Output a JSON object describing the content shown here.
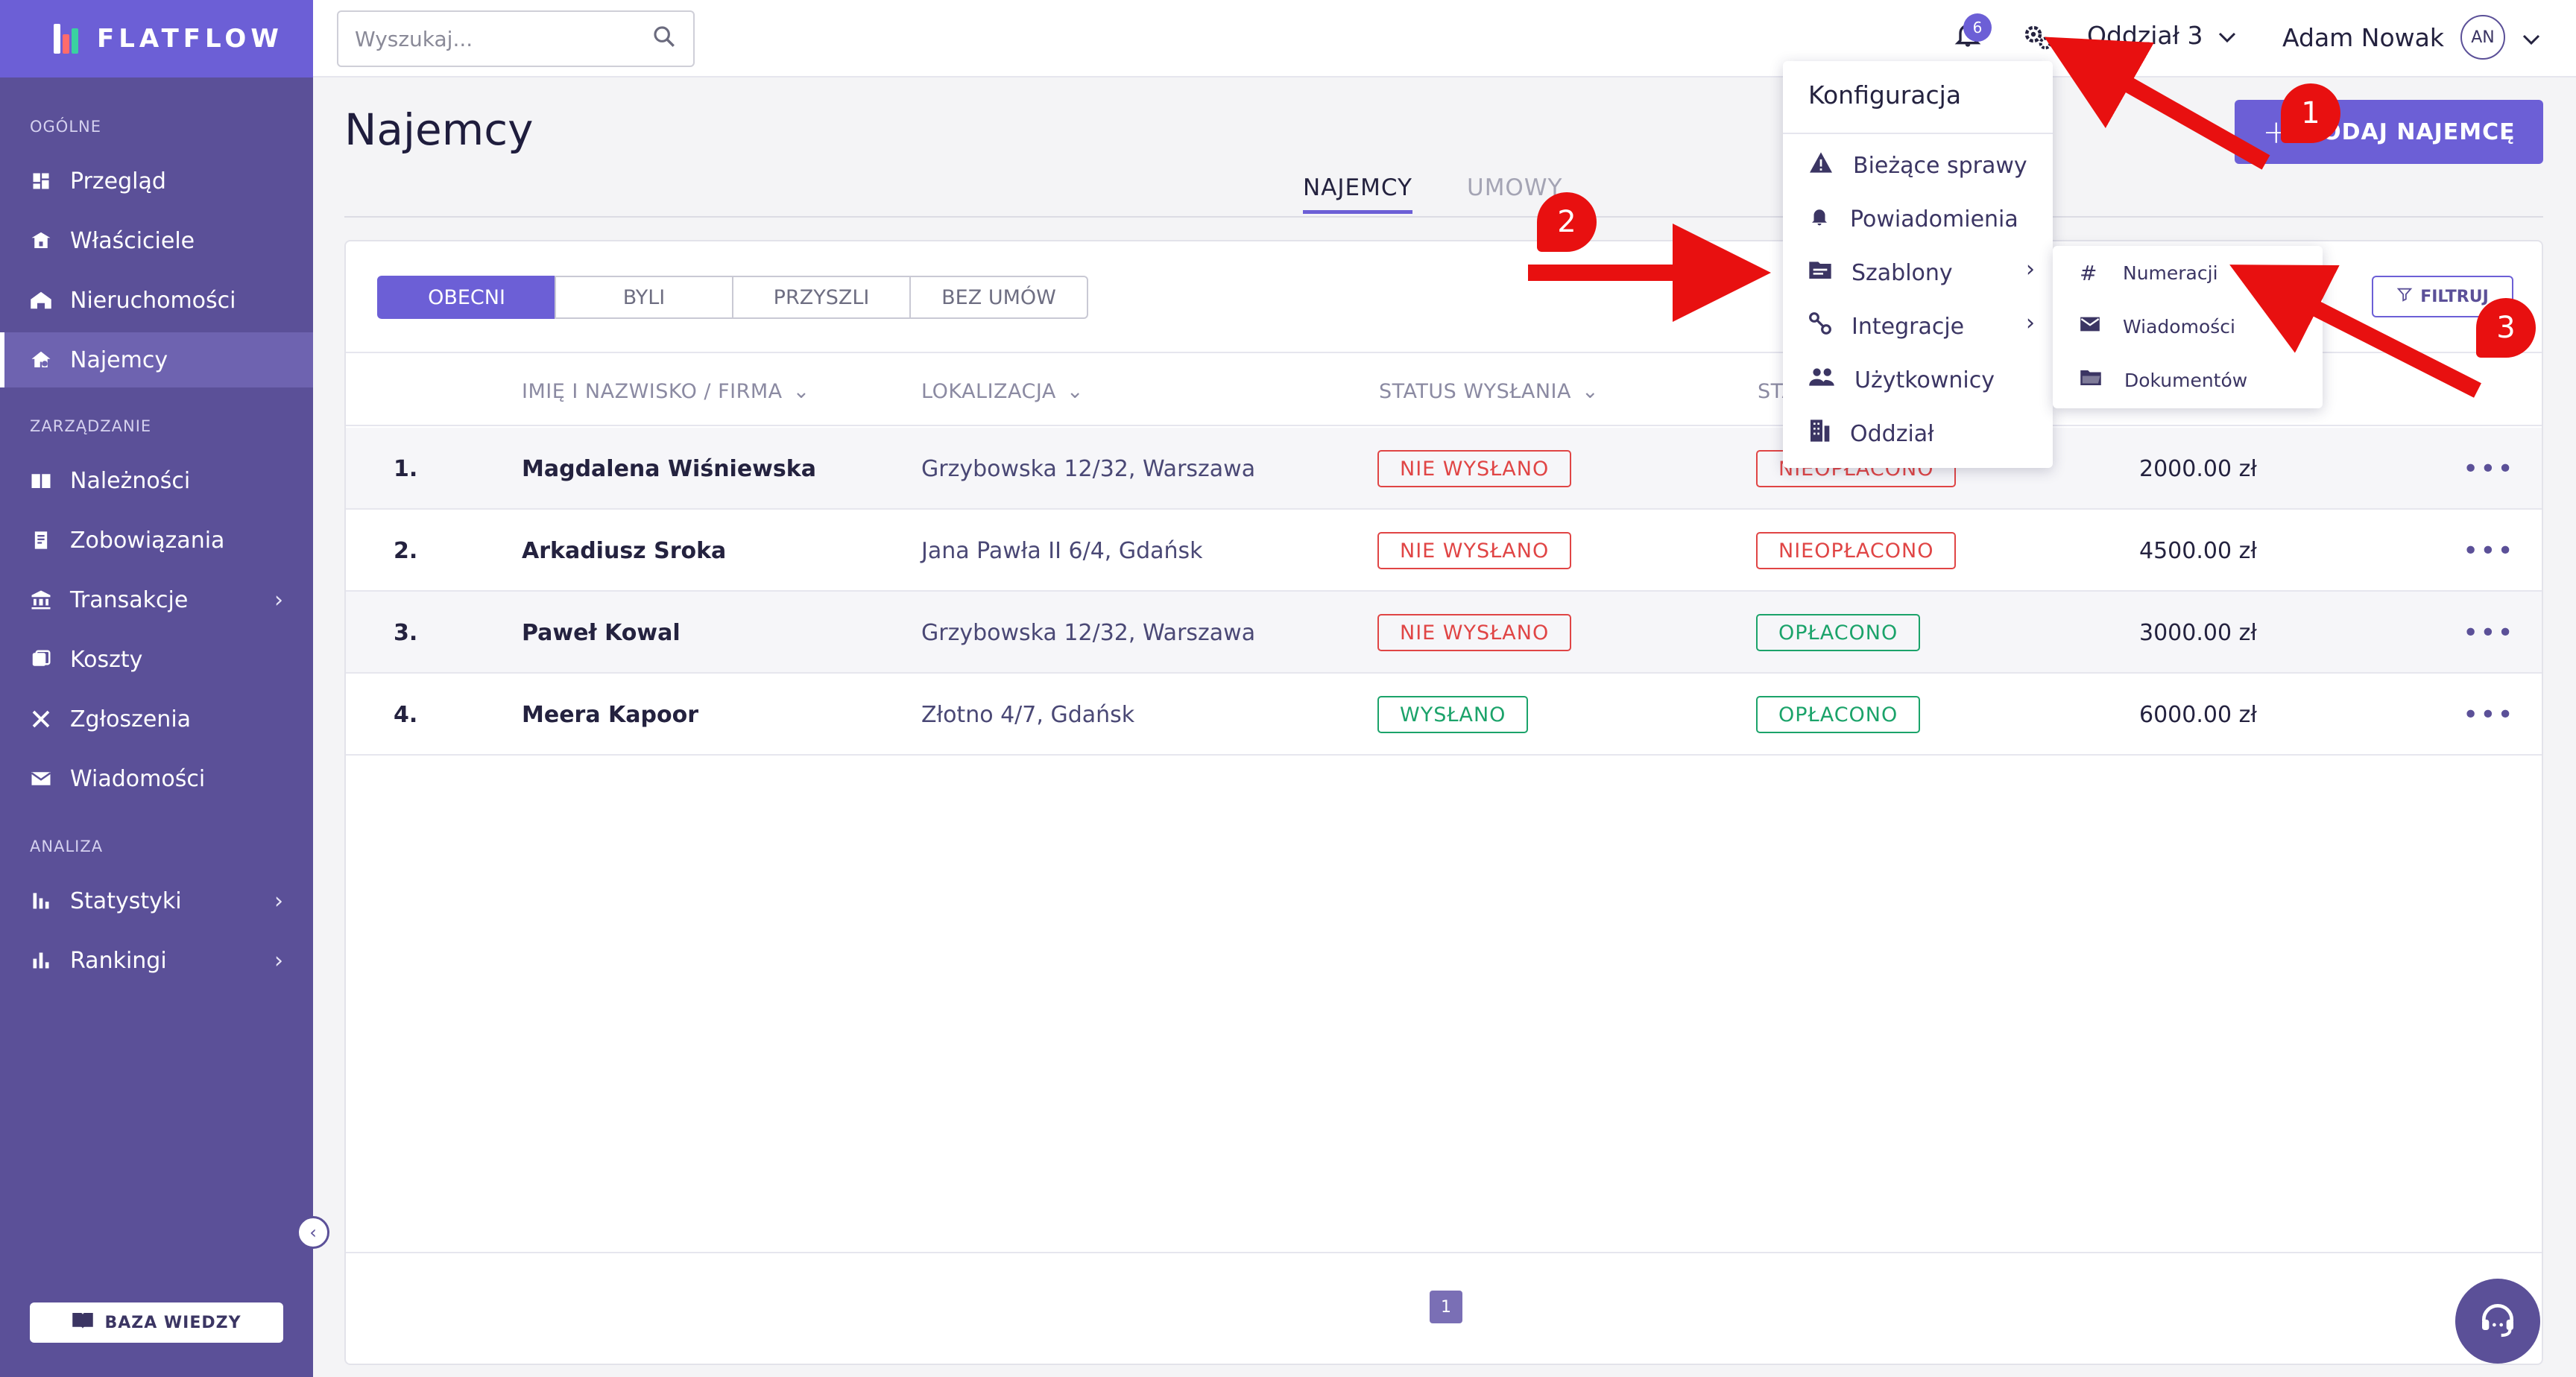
{
  "brand": {
    "name": "FLATFLOW"
  },
  "search": {
    "placeholder": "Wyszukaj..."
  },
  "topbar": {
    "notifications_count": "6",
    "branch": "Oddział 3",
    "user_name": "Adam Nowak",
    "user_initials": "AN"
  },
  "sidebar": {
    "sections": [
      {
        "label": "OGÓLNE"
      },
      {
        "label": "ZARZĄDZANIE"
      },
      {
        "label": "ANALIZA"
      }
    ],
    "items": [
      {
        "label": "Przegląd",
        "icon": "dashboard-icon"
      },
      {
        "label": "Właściciele",
        "icon": "owners-icon"
      },
      {
        "label": "Nieruchomości",
        "icon": "properties-icon"
      },
      {
        "label": "Najemcy",
        "icon": "tenants-icon",
        "active": true
      },
      {
        "label": "Należności",
        "icon": "receivables-icon"
      },
      {
        "label": "Zobowiązania",
        "icon": "liabilities-icon"
      },
      {
        "label": "Transakcje",
        "icon": "bank-icon",
        "has_submenu": true
      },
      {
        "label": "Koszty",
        "icon": "costs-icon"
      },
      {
        "label": "Zgłoszenia",
        "icon": "tools-icon"
      },
      {
        "label": "Wiadomości",
        "icon": "mail-icon"
      },
      {
        "label": "Statystyki",
        "icon": "stats-icon",
        "has_submenu": true
      },
      {
        "label": "Rankingi",
        "icon": "ranking-icon",
        "has_submenu": true
      }
    ],
    "knowledge_base": "BAZA WIEDZY"
  },
  "main": {
    "title": "Najemcy",
    "add_button": "DODAJ NAJEMCĘ",
    "tabs": [
      {
        "label": "NAJEMCY",
        "active": true
      },
      {
        "label": "UMOWY",
        "active": false
      }
    ],
    "segments": [
      {
        "label": "OBECNI",
        "active": true
      },
      {
        "label": "BYLI"
      },
      {
        "label": "PRZYSZLI"
      },
      {
        "label": "BEZ UMÓW"
      }
    ],
    "filter_label": "FILTRUJ",
    "columns": [
      "IMIĘ I NAZWISKO / FIRMA",
      "LOKALIZACJA",
      "STATUS WYSŁANIA",
      "STA"
    ],
    "rows": [
      {
        "num": "1.",
        "name": "Magdalena Wiśniewska",
        "location": "Grzybowska 12/32, Warszawa",
        "send_status": "NIE WYSŁANO",
        "pay_status": "NIEOPŁACONO",
        "amount": "2000.00 zł"
      },
      {
        "num": "2.",
        "name": "Arkadiusz Sroka",
        "location": "Jana Pawła II 6/4, Gdańsk",
        "send_status": "NIE WYSŁANO",
        "pay_status": "NIEOPŁACONO",
        "amount": "4500.00 zł"
      },
      {
        "num": "3.",
        "name": "Paweł Kowal",
        "location": "Grzybowska 12/32, Warszawa",
        "send_status": "NIE WYSŁANO",
        "pay_status": "OPŁACONO",
        "amount": "3000.00 zł"
      },
      {
        "num": "4.",
        "name": "Meera Kapoor",
        "location": "Złotno 4/7, Gdańsk",
        "send_status": "WYSŁANO",
        "pay_status": "OPŁACONO",
        "amount": "6000.00 zł"
      }
    ],
    "page": "1"
  },
  "config_menu": {
    "title": "Konfiguracja",
    "items": [
      {
        "label": "Bieżące sprawy",
        "icon": "warning-icon"
      },
      {
        "label": "Powiadomienia",
        "icon": "bell-icon"
      },
      {
        "label": "Szablony",
        "icon": "templates-icon",
        "has_submenu": true
      },
      {
        "label": "Integracje",
        "icon": "integrations-icon",
        "has_submenu": true
      },
      {
        "label": "Użytkownicy",
        "icon": "users-icon"
      },
      {
        "label": "Oddział",
        "icon": "building-icon"
      }
    ]
  },
  "templates_submenu": {
    "items": [
      {
        "label": "Numeracji",
        "icon": "hash-icon"
      },
      {
        "label": "Wiadomości",
        "icon": "mail-icon"
      },
      {
        "label": "Dokumentów",
        "icon": "folder-icon"
      }
    ]
  },
  "annotations": {
    "markers": [
      "1",
      "2",
      "3"
    ],
    "color": "#e81010"
  },
  "colors": {
    "sidebar": "#5b5098",
    "accent": "#6c5fd6",
    "danger": "#e04545",
    "success": "#1ba36a"
  }
}
